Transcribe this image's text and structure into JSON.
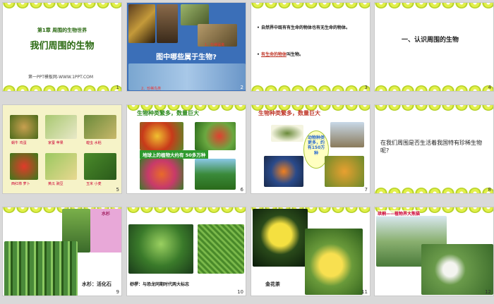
{
  "slides": [
    {
      "num": "1",
      "subtitle": "第1章 周围的生物世界",
      "title": "我们周围的生物",
      "footer": "第一PPT模板网-WWW.1PPT.COM"
    },
    {
      "num": "2",
      "question": "图中哪些属于生物?",
      "caption_top": "1、珍稀猛禽",
      "caption_bottom": "2、珍稀鸟类"
    },
    {
      "num": "3",
      "line1": "自然界中既有有生命的物体也有无生命的物体。",
      "line2_red": "有生命的物体",
      "line2_rest": "叫生物。"
    },
    {
      "num": "4",
      "heading": "一、认识周围的生物"
    },
    {
      "num": "5",
      "labels": [
        "蜗牛 鸡蛋",
        "家蚕 苹果",
        "蝗虫 水稻",
        "松鼠 玉米",
        "西红柿 萝卜",
        "黄瓜 豌豆",
        "南瓜 菜豆",
        "玉米 小麦"
      ]
    },
    {
      "num": "6",
      "title": "生物种类繁多，数量巨大",
      "banner": "地球上的植物大约有 50多万种"
    },
    {
      "num": "7",
      "title": "生物种类繁多，数量巨大",
      "bubble": "动物种类更多，约有150万种"
    },
    {
      "num": "8",
      "question": "在我们周围是否生活着我国特有珍稀生物呢?"
    },
    {
      "num": "9",
      "caption": "水杉：活化石",
      "card_title": "水杉"
    },
    {
      "num": "10",
      "caption": "桫椤：与恐龙同期时代两大标志"
    },
    {
      "num": "11",
      "caption": "金花茶"
    },
    {
      "num": "12",
      "caption": "珙桐——植物界大熊猫"
    }
  ]
}
